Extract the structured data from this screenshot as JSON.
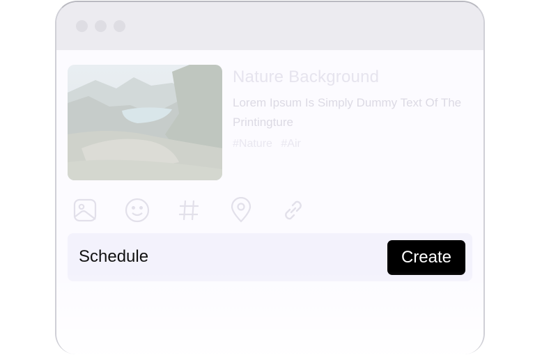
{
  "window": {
    "controls": [
      "close-dot",
      "minimize-dot",
      "maximize-dot"
    ]
  },
  "post": {
    "image_alt": "mountain lake landscape",
    "title": "Nature Background",
    "description": "Lorem Ipsum Is Simply Dummy Text Of The Printingture",
    "tags": [
      "#Nature",
      "#Air"
    ]
  },
  "toolbar": {
    "icons": [
      "image-icon",
      "emoji-icon",
      "hashtag-icon",
      "location-pin-icon",
      "link-icon"
    ]
  },
  "actions": {
    "schedule_label": "Schedule",
    "create_label": "Create"
  },
  "colors": {
    "accent": "#000000",
    "bar_background": "#f3f2fc",
    "titlebar": "#ecebf0"
  }
}
